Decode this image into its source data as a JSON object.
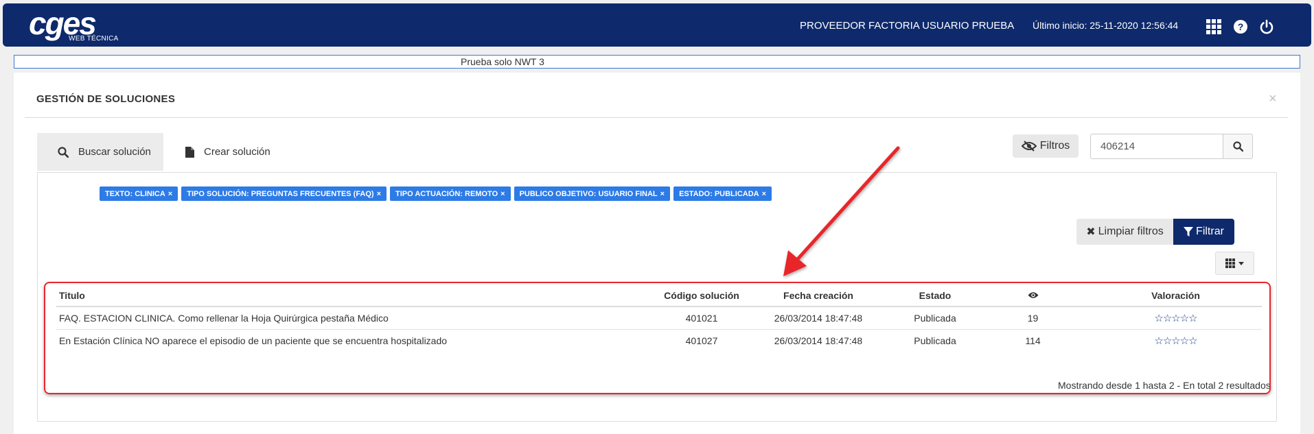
{
  "header": {
    "logo_text": "cges",
    "logo_sub": "WEB TÉCNICA",
    "user": "PROVEEDOR FACTORIA USUARIO PRUEBA",
    "last_login": "Último inicio: 25-11-2020 12:56:44",
    "icons": [
      "apps-grid-icon",
      "help-icon",
      "power-icon"
    ]
  },
  "announcement": "Prueba solo NWT 3",
  "panel": {
    "title": "GESTIÓN DE SOLUCIONES",
    "close_glyph": "×",
    "tabs": [
      {
        "label": "Buscar solución",
        "icon": "search-icon",
        "active": true
      },
      {
        "label": "Crear solución",
        "icon": "file-icon",
        "active": false
      }
    ],
    "filters_button": "Filtros",
    "search_value": "406214"
  },
  "filter_chips": [
    "TEXTO: CLINICA",
    "TIPO SOLUCIÓN: PREGUNTAS FRECUENTES (FAQ)",
    "TIPO ACTUACIÓN: REMOTO",
    "PUBLICO OBJETIVO: USUARIO FINAL",
    "ESTADO: PUBLICADA"
  ],
  "chip_close": "×",
  "actions": {
    "clear_filters": "Limpiar filtros",
    "clear_glyph": "✖",
    "filter": "Filtrar"
  },
  "table": {
    "columns": {
      "title": "Titulo",
      "code": "Código solución",
      "created": "Fecha creación",
      "status": "Estado",
      "rating": "Valoración"
    },
    "views_icon": "eye-icon",
    "rows": [
      {
        "title": "FAQ. ESTACION CLINICA. Como rellenar la Hoja Quirúrgica pestaña Médico",
        "code": "401021",
        "created": "26/03/2014 18:47:48",
        "status": "Publicada",
        "views": "19",
        "rating": "☆☆☆☆☆"
      },
      {
        "title": "En Estación Clínica NO aparece el episodio de un paciente que se encuentra hospitalizado",
        "code": "401027",
        "created": "26/03/2014 18:47:48",
        "status": "Publicada",
        "views": "114",
        "rating": "☆☆☆☆☆"
      }
    ],
    "pagination": "Mostrando desde 1 hasta 2 - En total 2 resultados"
  },
  "colors": {
    "navbar": "#0e2a6c",
    "chip": "#2d7be6",
    "filter_button": "#0e2a6c",
    "annotation": "#e8262c"
  }
}
